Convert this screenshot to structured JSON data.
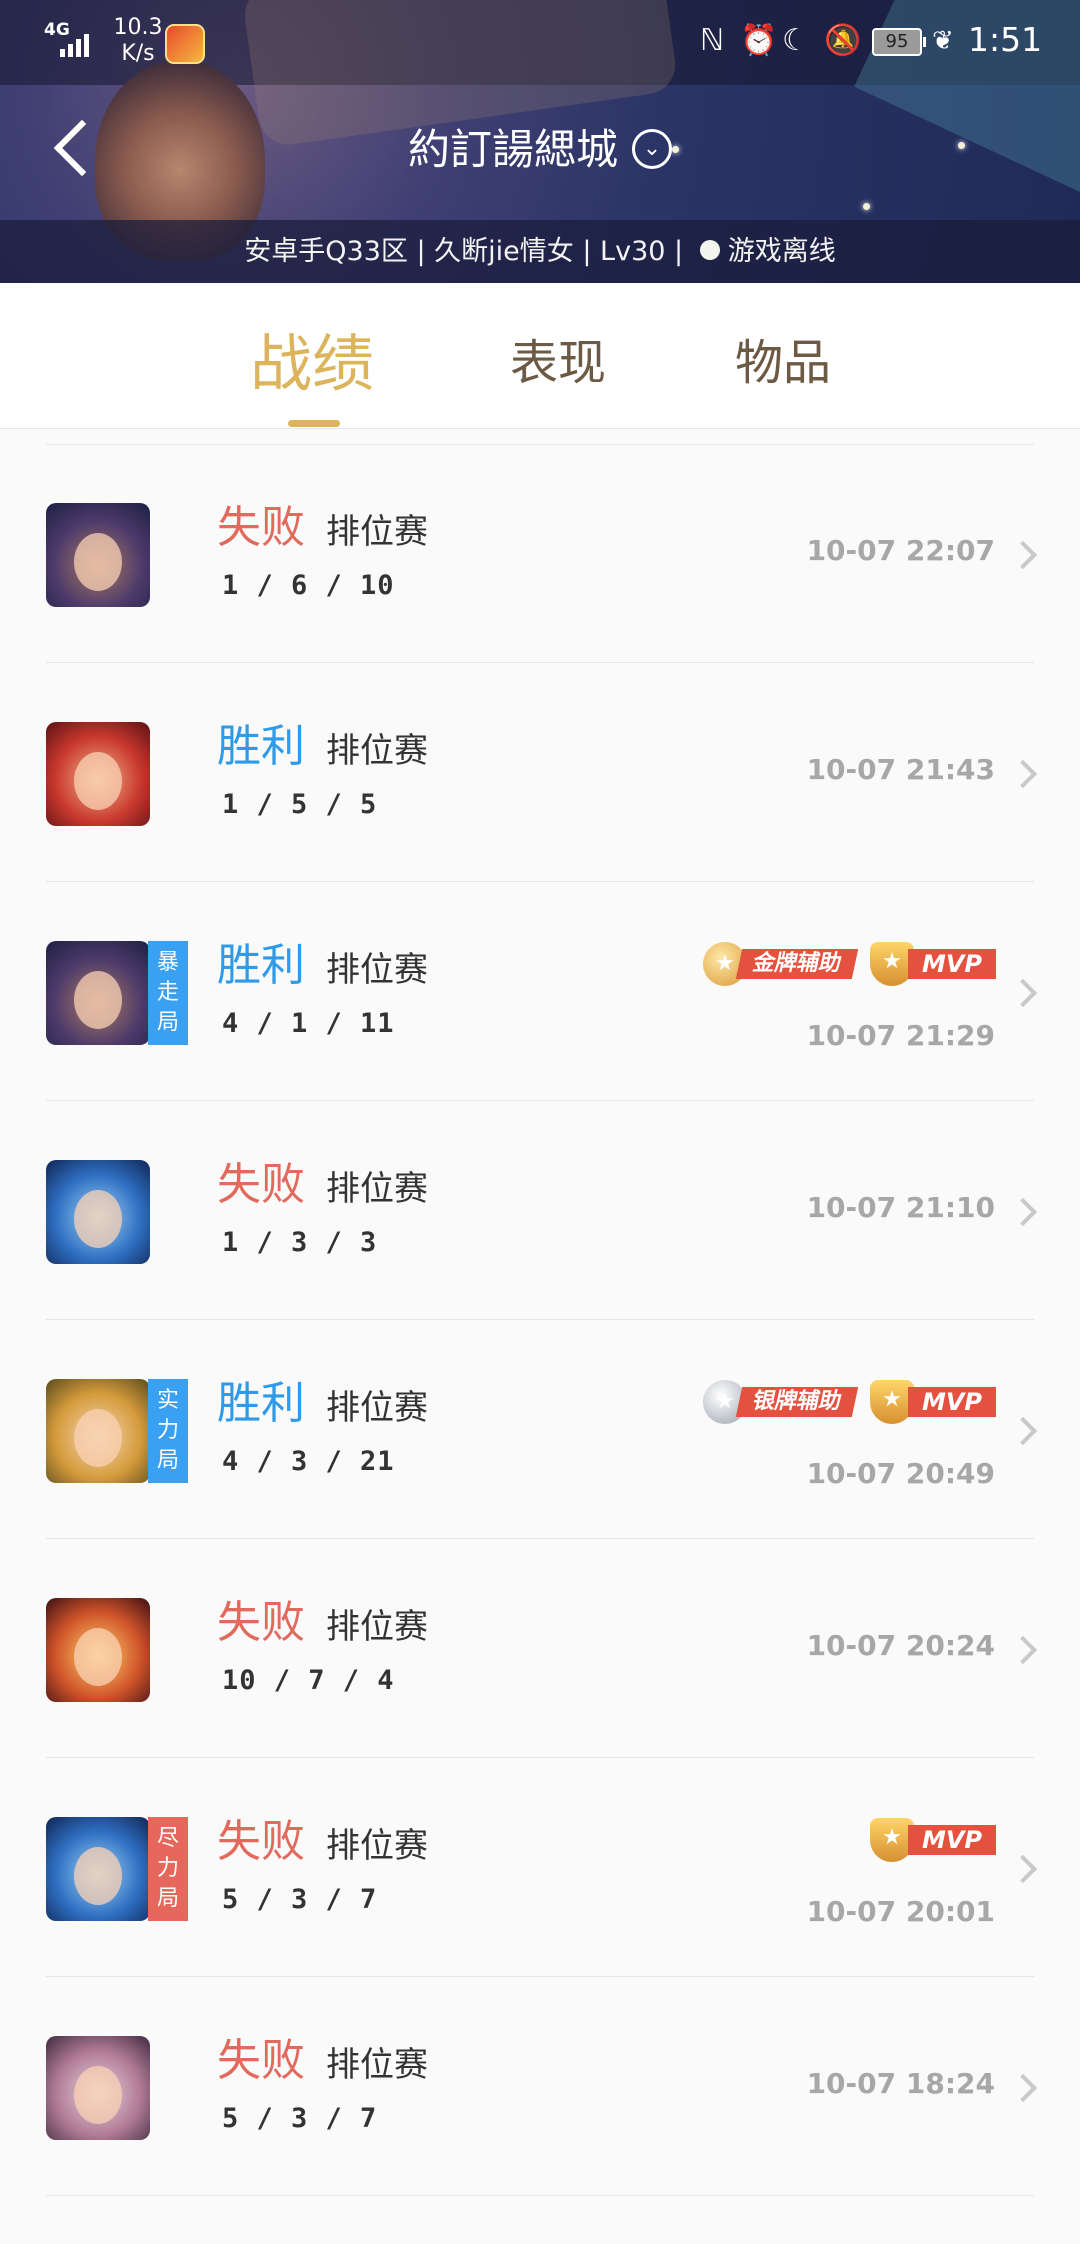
{
  "status_bar": {
    "network": "4G",
    "net_speed_value": "10.3",
    "net_speed_unit": "K/s",
    "battery": "95",
    "time": "1:51"
  },
  "header": {
    "title": "約訂諹緦城",
    "subtitle_parts": [
      "安卓手Q33区 | 久断jie情女 | Lv30 |",
      "游戏离线"
    ]
  },
  "tabs": [
    "战绩",
    "表现",
    "物品"
  ],
  "active_tab": 0,
  "colors": {
    "accent_gold": "#dcb45c",
    "win_blue": "#2f9be8",
    "loss_red": "#e26a5c",
    "tag_blue": "#3aa0f2",
    "tag_red": "#e6685c"
  },
  "matches": [
    {
      "result": "失败",
      "outcome": "loss",
      "mode": "排位赛",
      "kda": "1 / 6 / 10",
      "time": "10-07 22:07",
      "tag": null,
      "badges": []
    },
    {
      "result": "胜利",
      "outcome": "win",
      "mode": "排位赛",
      "kda": "1 / 5 / 5",
      "time": "10-07 21:43",
      "tag": null,
      "badges": []
    },
    {
      "result": "胜利",
      "outcome": "win",
      "mode": "排位赛",
      "kda": "4 / 1 / 11",
      "time": "10-07 21:29",
      "tag": "暴走局",
      "badges": [
        "金牌辅助",
        "MVP"
      ]
    },
    {
      "result": "失败",
      "outcome": "loss",
      "mode": "排位赛",
      "kda": "1 / 3 / 3",
      "time": "10-07 21:10",
      "tag": null,
      "badges": []
    },
    {
      "result": "胜利",
      "outcome": "win",
      "mode": "排位赛",
      "kda": "4 / 3 / 21",
      "time": "10-07 20:49",
      "tag": "实力局",
      "badges": [
        "银牌辅助",
        "MVP"
      ]
    },
    {
      "result": "失败",
      "outcome": "loss",
      "mode": "排位赛",
      "kda": "10 / 7 / 4",
      "time": "10-07 20:24",
      "tag": null,
      "badges": []
    },
    {
      "result": "失败",
      "outcome": "loss",
      "mode": "排位赛",
      "kda": "5 / 3 / 7",
      "time": "10-07 20:01",
      "tag": "尽力局",
      "badges": [
        "MVP"
      ]
    },
    {
      "result": "失败",
      "outcome": "loss",
      "mode": "排位赛",
      "kda": "5 / 3 / 7",
      "time": "10-07 18:24",
      "tag": null,
      "badges": []
    }
  ]
}
